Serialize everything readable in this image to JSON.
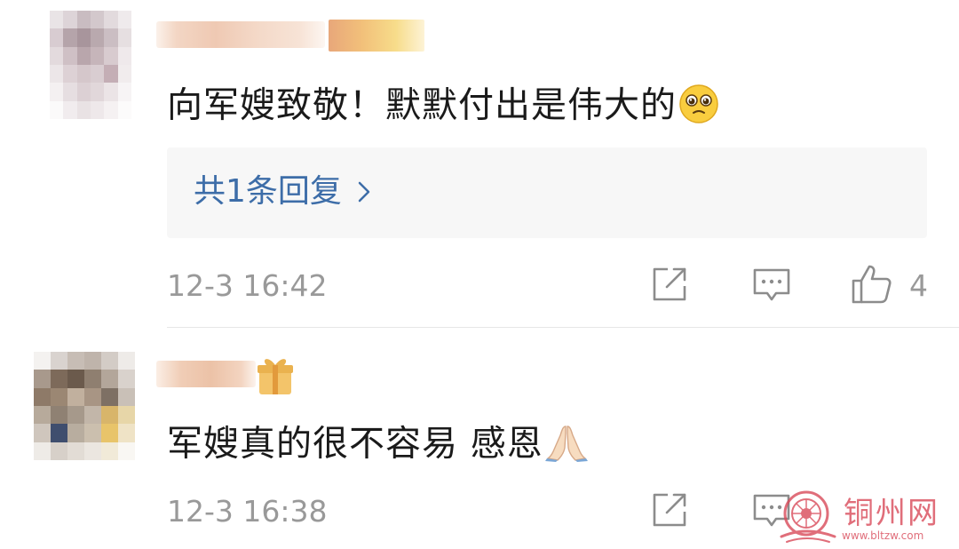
{
  "comments": [
    {
      "text": "向军嫂致敬！默默付出是伟大的",
      "emoji_icon": "pleading-face-icon",
      "replies_label": "共1条回复",
      "timestamp": "12-3 16:42",
      "like_count": "4"
    },
    {
      "text": "军嫂真的很不容易 感恩",
      "emoji_icon": "folded-hands-icon",
      "timestamp": "12-3 16:38"
    }
  ],
  "watermark": {
    "text": "铜州网",
    "url": "www.bltzw.com"
  },
  "colors": {
    "link": "#3d6da8",
    "meta": "#999999",
    "reply_bg": "#f7f7f7",
    "watermark": "#d94a5a"
  }
}
